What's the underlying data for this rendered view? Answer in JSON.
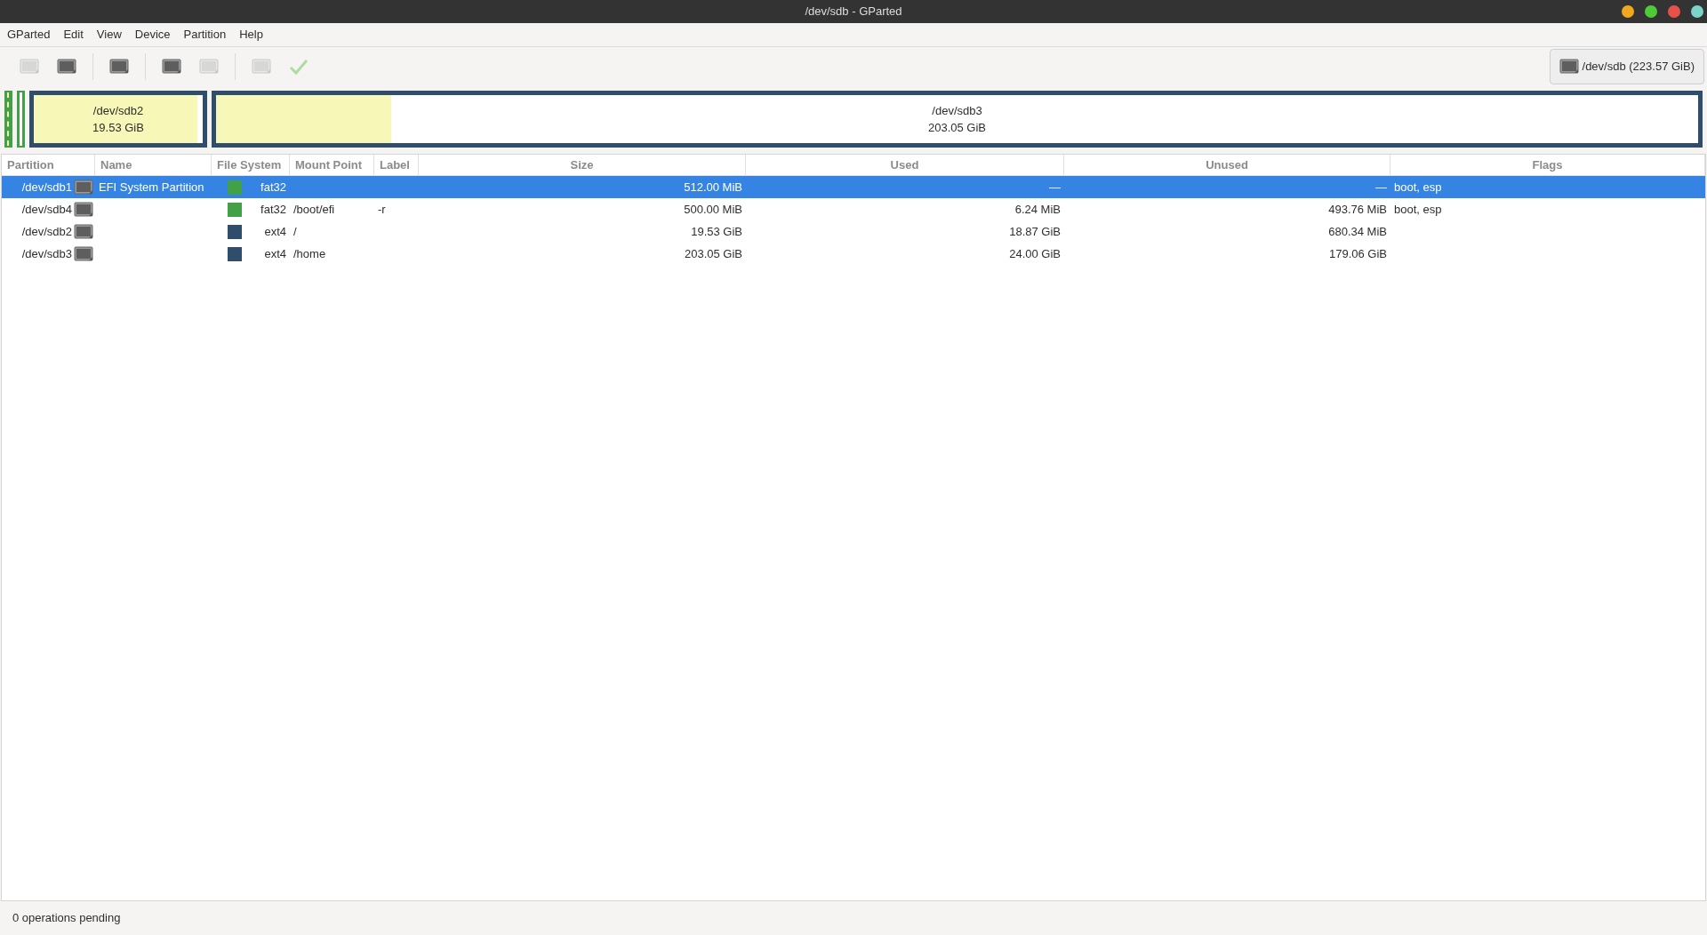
{
  "window": {
    "title": "/dev/sdb - GParted"
  },
  "menu": [
    "GParted",
    "Edit",
    "View",
    "Device",
    "Partition",
    "Help"
  ],
  "toolbar": [
    {
      "kind": "drive",
      "disabled": true
    },
    {
      "kind": "drive",
      "disabled": false
    },
    {
      "kind": "drive",
      "disabled": false
    },
    {
      "kind": "drive",
      "disabled": false
    },
    {
      "kind": "drive",
      "disabled": true
    },
    {
      "kind": "drive",
      "disabled": true
    },
    {
      "kind": "apply",
      "disabled": true
    }
  ],
  "device_selector": "/dev/sdb (223.57 GiB)",
  "partition_map": [
    {
      "kind": "small",
      "color": "#42a047",
      "selected": true
    },
    {
      "kind": "small",
      "color": "#42a047",
      "selected": false
    },
    {
      "kind": "large",
      "color": "#304e6b",
      "selected": false,
      "level": 0.966,
      "name": "/dev/sdb2",
      "size": "19.53 GiB"
    },
    {
      "kind": "large",
      "color": "#304e6b",
      "selected": false,
      "level": 0.118,
      "name": "/dev/sdb3",
      "size": "203.05 GiB"
    }
  ],
  "table": {
    "columns": [
      "Partition",
      "Name",
      "File System",
      "Mount Point",
      "Label",
      "Size",
      "Used",
      "Unused",
      "Flags"
    ],
    "rows": [
      {
        "partition": "/dev/sdb1",
        "name": "EFI System Partition",
        "color": "#42a047",
        "file_system": "fat32",
        "mount_point": "",
        "label": "",
        "size": "512.00 MiB",
        "used": "—",
        "unused": "—",
        "flags": "boot, esp",
        "selected": true
      },
      {
        "partition": "/dev/sdb4",
        "name": "",
        "color": "#42a047",
        "file_system": "fat32",
        "mount_point": "/boot/efi",
        "label": "-r",
        "size": "500.00 MiB",
        "used": "6.24 MiB",
        "unused": "493.76 MiB",
        "flags": "boot, esp",
        "selected": false
      },
      {
        "partition": "/dev/sdb2",
        "name": "",
        "color": "#304e6b",
        "file_system": "ext4",
        "mount_point": "/",
        "label": "",
        "size": "19.53 GiB",
        "used": "18.87 GiB",
        "unused": "680.34 MiB",
        "flags": "",
        "selected": false
      },
      {
        "partition": "/dev/sdb3",
        "name": "",
        "color": "#304e6b",
        "file_system": "ext4",
        "mount_point": "/home",
        "label": "",
        "size": "203.05 GiB",
        "used": "24.00 GiB",
        "unused": "179.06 GiB",
        "flags": "",
        "selected": false
      }
    ]
  },
  "status_bar": "0 operations pending"
}
